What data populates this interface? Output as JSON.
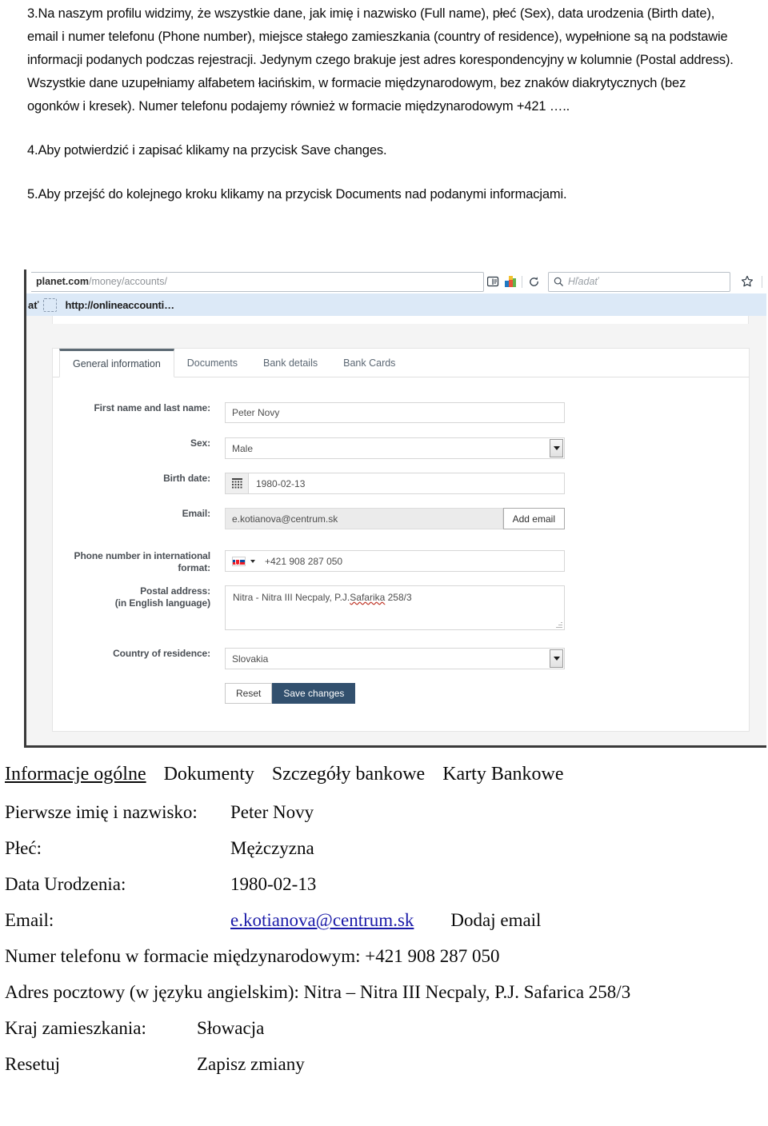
{
  "instructions": {
    "p3": "3.Na naszym profilu widzimy, że wszystkie dane, jak imię  i nazwisko (Full name), płeć (Sex), data urodzenia (Birth date), email i numer telefonu (Phone number), miejsce stałego zamieszkania (country of residence), wypełnione są na podstawie informacji podanych podczas rejestracji. Jedynym czego brakuje jest adres korespondencyjny w kolumnie (Postal address). Wszystkie dane uzupełniamy alfabetem łacińskim, w formacie międzynarodowym, bez znaków diakrytycznych (bez ogonków i kresek). Numer telefonu podajemy również w formacie międzynarodowym  +421 …..",
    "p4": "4.Aby potwierdzić i zapisać klikamy na przycisk Save changes.",
    "p5": "5.Aby przejść do kolejnego kroku klikamy na przycisk Documents nad podanymi informacjami."
  },
  "browser": {
    "url_bold": "planet.com",
    "url_rest": "/money/accounts/",
    "search_placeholder": "Hľadať",
    "bookmark_partial": "ať",
    "bookmark_label": "http://onlineaccounti…",
    "icons": {
      "reader": "reader-mode-icon",
      "pocket": "pocket-icon",
      "reload": "reload-icon",
      "search": "search-icon",
      "bookmark_star": "bookmark-star-icon",
      "library": "library-icon",
      "downloads": "downloads-arrow-icon"
    }
  },
  "webapp": {
    "tabs": [
      {
        "label": "General information",
        "active": true
      },
      {
        "label": "Documents",
        "active": false
      },
      {
        "label": "Bank details",
        "active": false
      },
      {
        "label": "Bank Cards",
        "active": false
      }
    ],
    "fields": {
      "name_label": "First name and last name:",
      "name_value": "Peter Novy",
      "sex_label": "Sex:",
      "sex_value": "Male",
      "birth_label": "Birth date:",
      "birth_value": "1980-02-13",
      "email_label": "Email:",
      "email_value": "e.kotianova@centrum.sk",
      "add_email_label": "Add email",
      "phone_label": "Phone number in international format:",
      "phone_value": "+421 908 287 050",
      "phone_flag": "slovakia-flag-icon",
      "postal_label_1": "Postal address:",
      "postal_label_2": "(in English language)",
      "postal_value_a": "Nitra - Nitra III Necpaly, P.J.",
      "postal_value_b": "Safarika",
      "postal_value_c": " 258/3",
      "country_label": "Country of residence:",
      "country_value": "Slovakia"
    },
    "buttons": {
      "reset": "Reset",
      "save": "Save changes"
    },
    "colors": {
      "save_button": "#32506e",
      "active_tab_border": "#5d6a74",
      "bookmarks_bar": "#dce9f7"
    }
  },
  "translation": {
    "tabs": [
      "Informacje ogólne",
      "Dokumenty",
      "Szczegóły bankowe",
      "Karty Bankowe"
    ],
    "rows": [
      {
        "key": "Pierwsze imię i nazwisko:",
        "value": "Peter Novy"
      },
      {
        "key": "Płeć:",
        "value": "Mężczyzna"
      },
      {
        "key": "Data Urodzenia:",
        "value": "1980-02-13"
      }
    ],
    "email_key": "Email:",
    "email_link": "e.kotianova@centrum.sk",
    "email_action": "Dodaj email",
    "phone_line": "Numer telefonu w formacie międzynarodowym: +421 908 287 050",
    "address_line": "Adres pocztowy (w języku angielskim): Nitra – Nitra III Necpaly, P.J. Safarica 258/3",
    "country_key": "Kraj zamieszkania:",
    "country_value": "Słowacja",
    "reset_label": "Resetuj",
    "save_label": "Zapisz zmiany"
  }
}
